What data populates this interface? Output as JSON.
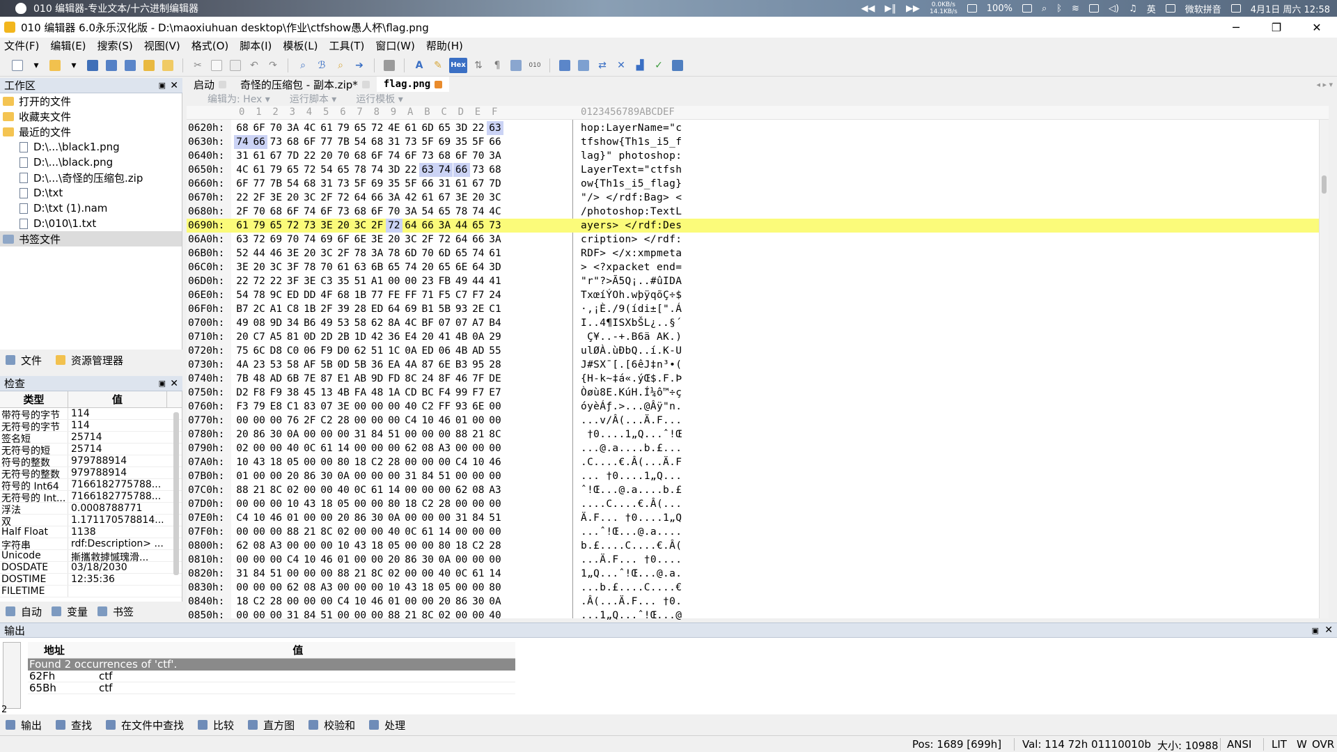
{
  "mac_bar": {
    "app_title": "010 编辑器-专业文本/十六进制编辑器",
    "net_speed_up": "0.0KB/s",
    "net_speed_down": "14.1KB/s",
    "battery": "100%",
    "lang_en": "英",
    "ime": "微软拼音",
    "datetime": "4月1日 周六 12:58"
  },
  "window": {
    "title": "010 编辑器 6.0永乐汉化版 - D:\\maoxiuhuan desktop\\作业\\ctfshow愚人杯\\flag.png"
  },
  "menu": [
    "文件(F)",
    "编辑(E)",
    "搜索(S)",
    "视图(V)",
    "格式(O)",
    "脚本(I)",
    "模板(L)",
    "工具(T)",
    "窗口(W)",
    "帮助(H)"
  ],
  "toolbar": {
    "hex_label": "Hex"
  },
  "workspace": {
    "title": "工作区",
    "items": [
      {
        "label": "打开的文件",
        "kind": "folder"
      },
      {
        "label": "收藏夹文件",
        "kind": "folder"
      },
      {
        "label": "最近的文件",
        "kind": "folder"
      },
      {
        "label": "D:\\...\\black1.png",
        "kind": "file"
      },
      {
        "label": "D:\\...\\black.png",
        "kind": "file"
      },
      {
        "label": "D:\\...\\奇怪的压缩包.zip",
        "kind": "file"
      },
      {
        "label": "D:\\txt",
        "kind": "file"
      },
      {
        "label": "D:\\txt (1).nam",
        "kind": "file"
      },
      {
        "label": "D:\\010\\1.txt",
        "kind": "file"
      },
      {
        "label": "书签文件",
        "kind": "folder"
      }
    ],
    "tabs": [
      "文件",
      "资源管理器"
    ]
  },
  "inspector": {
    "title": "检查",
    "col_type": "类型",
    "col_value": "值",
    "rows": [
      {
        "k": "带符号的字节",
        "v": "114"
      },
      {
        "k": "无符号的字节",
        "v": "114"
      },
      {
        "k": "签名短",
        "v": "25714"
      },
      {
        "k": "无符号的短",
        "v": "25714"
      },
      {
        "k": "符号的整数",
        "v": "979788914"
      },
      {
        "k": "无符号的整数",
        "v": "979788914"
      },
      {
        "k": "符号的 Int64",
        "v": "7166182775788..."
      },
      {
        "k": "无符号的 Int...",
        "v": "7166182775788..."
      },
      {
        "k": "浮法",
        "v": "0.0008788771"
      },
      {
        "k": "双",
        "v": "1.171170578814..."
      },
      {
        "k": "Half Float",
        "v": "1138"
      },
      {
        "k": "字符串",
        "v": "rdf:Description> ..."
      },
      {
        "k": "Unicode",
        "v": "摲攜敹摢慽瑰滑..."
      },
      {
        "k": "DOSDATE",
        "v": "03/18/2030"
      },
      {
        "k": "DOSTIME",
        "v": "12:35:36"
      },
      {
        "k": "FILETIME",
        "v": ""
      }
    ],
    "tabs": [
      "自动",
      "变量",
      "书签"
    ]
  },
  "editor": {
    "tabs": [
      "启动",
      "奇怪的压缩包 - 副本.zip*",
      "flag.png"
    ],
    "toolbar": [
      "编辑为: Hex ▾",
      "运行脚本 ▾",
      "运行模板 ▾"
    ],
    "col_header": [
      "0",
      "1",
      "2",
      "3",
      "4",
      "5",
      "6",
      "7",
      "8",
      "9",
      "A",
      "B",
      "C",
      "D",
      "E",
      "F"
    ],
    "ascii_header": "0123456789ABCDEF",
    "rows": [
      {
        "addr": "0620h:",
        "hex": "68 6F 70 3A 4C 61 79 65 72 4E 61 6D 65 3D 22 63",
        "ascii": "hop:LayerName=\"c"
      },
      {
        "addr": "0630h:",
        "hex": "74 66 73 68 6F 77 7B 54 68 31 73 5F 69 35 5F 66",
        "ascii": "tfshow{Th1s_i5_f"
      },
      {
        "addr": "0640h:",
        "hex": "31 61 67 7D 22 20 70 68 6F 74 6F 73 68 6F 70 3A",
        "ascii": "lag}\" photoshop:"
      },
      {
        "addr": "0650h:",
        "hex": "4C 61 79 65 72 54 65 78 74 3D 22 63 74 66 73 68",
        "ascii": "LayerText=\"ctfsh"
      },
      {
        "addr": "0660h:",
        "hex": "6F 77 7B 54 68 31 73 5F 69 35 5F 66 31 61 67 7D",
        "ascii": "ow{Th1s_i5_flag}"
      },
      {
        "addr": "0670h:",
        "hex": "22 2F 3E 20 3C 2F 72 64 66 3A 42 61 67 3E 20 3C",
        "ascii": "\"/> </rdf:Bag> <"
      },
      {
        "addr": "0680h:",
        "hex": "2F 70 68 6F 74 6F 73 68 6F 70 3A 54 65 78 74 4C",
        "ascii": "/photoshop:TextL"
      },
      {
        "addr": "0690h:",
        "hex": "61 79 65 72 73 3E 20 3C 2F 72 64 66 3A 44 65 73",
        "ascii": "ayers> </rdf:Des"
      },
      {
        "addr": "06A0h:",
        "hex": "63 72 69 70 74 69 6F 6E 3E 20 3C 2F 72 64 66 3A",
        "ascii": "cription> </rdf:"
      },
      {
        "addr": "06B0h:",
        "hex": "52 44 46 3E 20 3C 2F 78 3A 78 6D 70 6D 65 74 61",
        "ascii": "RDF> </x:xmpmeta"
      },
      {
        "addr": "06C0h:",
        "hex": "3E 20 3C 3F 78 70 61 63 6B 65 74 20 65 6E 64 3D",
        "ascii": "> <?xpacket end="
      },
      {
        "addr": "06D0h:",
        "hex": "22 72 22 3F 3E C3 35 51 A1 00 00 23 FB 49 44 41",
        "ascii": "\"r\"?>Ã5Q¡..#ûIDA"
      },
      {
        "addr": "06E0h:",
        "hex": "54 78 9C ED DD 4F 68 1B 77 FE FF 71 F5 C7 F7 24",
        "ascii": "TxœíÝOh.wþÿqõÇ÷$"
      },
      {
        "addr": "06F0h:",
        "hex": "B7 2C A1 C8 1B 2F 39 28 ED 64 69 B1 5B 93 2E C1",
        "ascii": "·,¡È./9(ídi±[\".Á"
      },
      {
        "addr": "0700h:",
        "hex": "49 08 9D 34 B6 49 53 58 62 8A 4C BF 07 07 A7 B4",
        "ascii": "I..4¶ISXbŠL¿..§´"
      },
      {
        "addr": "0710h:",
        "hex": "20 C7 A5 81 0D 2D 2B 1D 42 36 E4 20 41 4B 0A 29",
        "ascii": " Ç¥..-+.B6ä AK.)"
      },
      {
        "addr": "0720h:",
        "hex": "75 6C D8 C0 06 F9 D0 62 51 1C 0A ED 06 4B AD 55",
        "ascii": "ulØÀ.ùÐbQ..í.K-U"
      },
      {
        "addr": "0730h:",
        "hex": "4A 23 53 58 AF 5B 0D 5B 36 EA 4A 87 6E B3 95 28",
        "ascii": "J#SX¯[.[6êJ‡n³•("
      },
      {
        "addr": "0740h:",
        "hex": "7B 48 AD 6B 7E 87 E1 AB 9D FD 8C 24 8F 46 7F DE",
        "ascii": "{H-k~‡á«.ýŒ$.F.Þ"
      },
      {
        "addr": "0750h:",
        "hex": "D2 F8 F9 38 45 13 4B FA 48 1A CD BC F4 99 F7 E7",
        "ascii": "Òøù8E.KúH.Í¼ô™÷ç"
      },
      {
        "addr": "0760h:",
        "hex": "F3 79 E8 C1 83 07 3E 00 00 00 40 C2 FF 93 6E 00",
        "ascii": "óyèÁƒ.>...@Âÿ\"n."
      },
      {
        "addr": "0770h:",
        "hex": "00 00 00 76 2F C2 28 00 00 00 C4 10 46 01 00 00",
        "ascii": "...v/Â(...Ä.F..."
      },
      {
        "addr": "0780h:",
        "hex": "20 86 30 0A 00 00 00 31 84 51 00 00 00 88 21 8C",
        "ascii": " †0....1„Q...ˆ!Œ"
      },
      {
        "addr": "0790h:",
        "hex": "02 00 00 40 0C 61 14 00 00 00 62 08 A3 00 00 00",
        "ascii": "...@.a....b.£..."
      },
      {
        "addr": "07A0h:",
        "hex": "10 43 18 05 00 00 80 18 C2 28 00 00 00 C4 10 46",
        "ascii": ".C....€.Â(...Ä.F"
      },
      {
        "addr": "07B0h:",
        "hex": "01 00 00 20 86 30 0A 00 00 00 31 84 51 00 00 00",
        "ascii": "... †0....1„Q..."
      },
      {
        "addr": "07C0h:",
        "hex": "88 21 8C 02 00 00 40 0C 61 14 00 00 00 62 08 A3",
        "ascii": "ˆ!Œ...@.a....b.£"
      },
      {
        "addr": "07D0h:",
        "hex": "00 00 00 10 43 18 05 00 00 80 18 C2 28 00 00 00",
        "ascii": "....C....€.Â(..."
      },
      {
        "addr": "07E0h:",
        "hex": "C4 10 46 01 00 00 20 86 30 0A 00 00 00 31 84 51",
        "ascii": "Ä.F... †0....1„Q"
      },
      {
        "addr": "07F0h:",
        "hex": "00 00 00 88 21 8C 02 00 00 40 0C 61 14 00 00 00",
        "ascii": "...ˆ!Œ...@.a...."
      },
      {
        "addr": "0800h:",
        "hex": "62 08 A3 00 00 00 10 43 18 05 00 00 80 18 C2 28",
        "ascii": "b.£....C....€.Â("
      },
      {
        "addr": "0810h:",
        "hex": "00 00 00 C4 10 46 01 00 00 20 86 30 0A 00 00 00",
        "ascii": "...Ä.F... †0...."
      },
      {
        "addr": "0820h:",
        "hex": "31 84 51 00 00 00 88 21 8C 02 00 00 40 0C 61 14",
        "ascii": "1„Q...ˆ!Œ...@.a."
      },
      {
        "addr": "0830h:",
        "hex": "00 00 00 62 08 A3 00 00 00 10 43 18 05 00 00 80",
        "ascii": "...b.£....C....€"
      },
      {
        "addr": "0840h:",
        "hex": "18 C2 28 00 00 00 C4 10 46 01 00 00 20 86 30 0A",
        "ascii": ".Â(...Ä.F... †0."
      },
      {
        "addr": "0850h:",
        "hex": "00 00 00 31 84 51 00 00 00 88 21 8C 02 00 00 40",
        "ascii": "...1„Q...ˆ!Œ...@"
      }
    ],
    "current_row": "0690h:"
  },
  "output": {
    "title": "输出",
    "col_addr": "地址",
    "col_value": "值",
    "found": "Found 2 occurrences of 'ctf'.",
    "results": [
      {
        "addr": "62Fh",
        "value": "ctf"
      },
      {
        "addr": "65Bh",
        "value": "ctf"
      }
    ],
    "count": "2",
    "tabs": [
      "输出",
      "查找",
      "在文件中查找",
      "比较",
      "直方图",
      "校验和",
      "处理"
    ]
  },
  "status": {
    "pos": "Pos: 1689 [699h]",
    "val": "Val: 114 72h 01110010b",
    "size": "大小: 10988",
    "encoding": "ANSI",
    "endian": "LIT",
    "mode_w": "W",
    "mode_ovr": "OVR"
  }
}
